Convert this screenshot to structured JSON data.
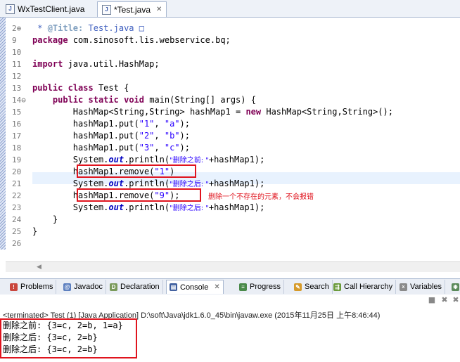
{
  "editor_tabs": [
    {
      "label": "WxTestClient.java",
      "active": false,
      "closable": false
    },
    {
      "label": "*Test.java",
      "active": true,
      "closable": true
    }
  ],
  "code_lines": [
    {
      "num": "2⊕",
      "tokens": [
        {
          "t": " * ",
          "c": "cmt"
        },
        {
          "t": "@Title:",
          "c": "cmtag"
        },
        {
          "t": " Test.java □",
          "c": "cmt"
        }
      ]
    },
    {
      "num": "9",
      "tokens": [
        {
          "t": "package",
          "c": "kw"
        },
        {
          "t": " com.sinosoft.lis.webservice.bq;",
          "c": ""
        }
      ]
    },
    {
      "num": "10",
      "tokens": []
    },
    {
      "num": "11",
      "tokens": [
        {
          "t": "import",
          "c": "kw"
        },
        {
          "t": " java.util.HashMap;",
          "c": ""
        }
      ]
    },
    {
      "num": "12",
      "tokens": []
    },
    {
      "num": "13",
      "tokens": [
        {
          "t": "public",
          "c": "kw"
        },
        {
          "t": " ",
          "c": ""
        },
        {
          "t": "class",
          "c": "kw"
        },
        {
          "t": " Test {",
          "c": ""
        }
      ]
    },
    {
      "num": "14⊖",
      "tokens": [
        {
          "t": "    ",
          "c": ""
        },
        {
          "t": "public",
          "c": "kw"
        },
        {
          "t": " ",
          "c": ""
        },
        {
          "t": "static",
          "c": "kw"
        },
        {
          "t": " ",
          "c": ""
        },
        {
          "t": "void",
          "c": "kw"
        },
        {
          "t": " main(String[] args) {",
          "c": ""
        }
      ]
    },
    {
      "num": "15",
      "tokens": [
        {
          "t": "        HashMap<String,String> hashMap1 = ",
          "c": ""
        },
        {
          "t": "new",
          "c": "kw"
        },
        {
          "t": " HashMap<String,String>();",
          "c": ""
        }
      ]
    },
    {
      "num": "16",
      "tokens": [
        {
          "t": "        hashMap1.put(",
          "c": ""
        },
        {
          "t": "\"1\"",
          "c": "str"
        },
        {
          "t": ", ",
          "c": ""
        },
        {
          "t": "\"a\"",
          "c": "str"
        },
        {
          "t": ");",
          "c": ""
        }
      ]
    },
    {
      "num": "17",
      "tokens": [
        {
          "t": "        hashMap1.put(",
          "c": ""
        },
        {
          "t": "\"2\"",
          "c": "str"
        },
        {
          "t": ", ",
          "c": ""
        },
        {
          "t": "\"b\"",
          "c": "str"
        },
        {
          "t": ");",
          "c": ""
        }
      ]
    },
    {
      "num": "18",
      "tokens": [
        {
          "t": "        hashMap1.put(",
          "c": ""
        },
        {
          "t": "\"3\"",
          "c": "str"
        },
        {
          "t": ", ",
          "c": ""
        },
        {
          "t": "\"c\"",
          "c": "str"
        },
        {
          "t": ");",
          "c": ""
        }
      ]
    },
    {
      "num": "19",
      "tokens": [
        {
          "t": "        System.",
          "c": ""
        },
        {
          "t": "out",
          "c": "fld"
        },
        {
          "t": ".println(",
          "c": ""
        },
        {
          "t": "\"删除之前: \"",
          "c": "str"
        },
        {
          "t": "+hashMap1);",
          "c": ""
        }
      ]
    },
    {
      "num": "20",
      "tokens": [
        {
          "t": "        hashMap1.remove(",
          "c": ""
        },
        {
          "t": "\"1\"",
          "c": "str"
        },
        {
          "t": ")",
          "c": ""
        }
      ]
    },
    {
      "num": "21",
      "tokens": [
        {
          "t": "        System.",
          "c": ""
        },
        {
          "t": "out",
          "c": "fld"
        },
        {
          "t": ".println(",
          "c": ""
        },
        {
          "t": "\"删除之后: \"",
          "c": "str"
        },
        {
          "t": "+hashMap1);",
          "c": ""
        }
      ]
    },
    {
      "num": "22",
      "tokens": [
        {
          "t": "        hashMap1.remove(",
          "c": ""
        },
        {
          "t": "\"9\"",
          "c": "str"
        },
        {
          "t": ");",
          "c": ""
        }
      ]
    },
    {
      "num": "23",
      "tokens": [
        {
          "t": "        System.",
          "c": ""
        },
        {
          "t": "out",
          "c": "fld"
        },
        {
          "t": ".println(",
          "c": ""
        },
        {
          "t": "\"删除之后: \"",
          "c": "str"
        },
        {
          "t": "+hashMap1);",
          "c": ""
        }
      ]
    },
    {
      "num": "24",
      "tokens": [
        {
          "t": "    }",
          "c": ""
        }
      ]
    },
    {
      "num": "25",
      "tokens": [
        {
          "t": "}",
          "c": ""
        }
      ]
    },
    {
      "num": "26",
      "tokens": []
    }
  ],
  "annotation": "删除一个不存在的元素，不会报错",
  "view_tabs": [
    {
      "label": "Problems",
      "icon": "problems-icon",
      "active": false
    },
    {
      "label": "Javadoc",
      "icon": "javadoc-icon",
      "active": false
    },
    {
      "label": "Declaration",
      "icon": "declaration-icon",
      "active": false
    },
    {
      "label": "Console",
      "icon": "console-icon",
      "active": true
    },
    {
      "label": "Progress",
      "icon": "progress-icon",
      "active": false
    },
    {
      "label": "Search",
      "icon": "search-icon",
      "active": false
    },
    {
      "label": "Call Hierarchy",
      "icon": "call-hierarchy-icon",
      "active": false
    },
    {
      "label": "Variables",
      "icon": "variables-icon",
      "active": false
    }
  ],
  "console": {
    "terminated_line": "<terminated> Test (1) [Java Application] D:\\soft\\Java\\jdk1.6.0_45\\bin\\javaw.exe (2015年11月25日 上午8:46:44)",
    "output": [
      "删除之前: {3=c, 2=b, 1=a}",
      "删除之后: {3=c, 2=b}",
      "删除之后: {3=c, 2=b}"
    ]
  },
  "colors": {
    "keyword": "#7f0055",
    "string": "#2a00ff",
    "annotation_red": "#e0141e",
    "current_line": "#e8f2fe"
  }
}
